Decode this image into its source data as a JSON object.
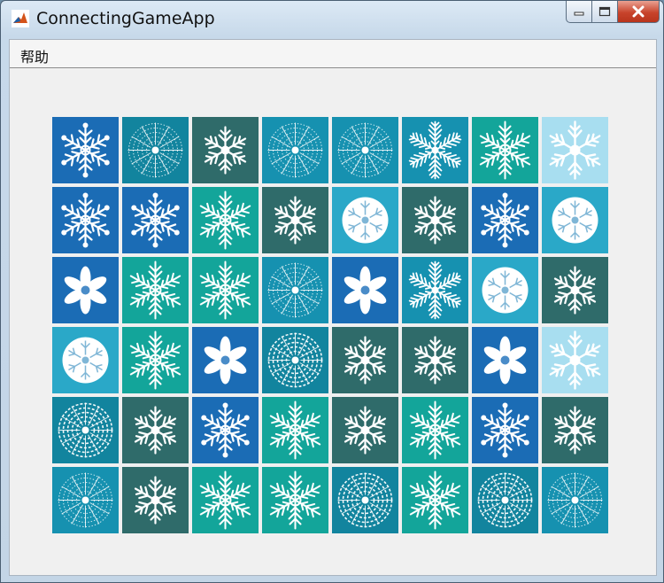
{
  "window": {
    "title": "ConnectingGameApp",
    "icon": "matlab-icon"
  },
  "menubar": {
    "items": [
      {
        "label": "帮助"
      }
    ]
  },
  "palette": {
    "A": "#1b6cb5",
    "B": "#1691b0",
    "C": "#2f6b6a",
    "D": "#13a59a",
    "E": "#2aa8c8",
    "F": "#a8def0",
    "G": "#12849e"
  },
  "board": {
    "rows": [
      [
        {
          "bg": "A",
          "icon": "snowflake-ornate-icon"
        },
        {
          "bg": "G",
          "icon": "mandala-snowflake-icon"
        },
        {
          "bg": "C",
          "icon": "snowflake-branch-icon"
        },
        {
          "bg": "B",
          "icon": "mandala-snowflake-icon"
        },
        {
          "bg": "B",
          "icon": "mandala-snowflake-icon"
        },
        {
          "bg": "B",
          "icon": "snowflake-fern-icon"
        },
        {
          "bg": "D",
          "icon": "snowflake-star-icon"
        },
        {
          "bg": "F",
          "icon": "snowflake-simple-icon"
        }
      ],
      [
        {
          "bg": "A",
          "icon": "snowflake-ornate-icon"
        },
        {
          "bg": "A",
          "icon": "snowflake-ornate-icon"
        },
        {
          "bg": "D",
          "icon": "snowflake-star-icon"
        },
        {
          "bg": "C",
          "icon": "snowflake-branch-icon"
        },
        {
          "bg": "E",
          "icon": "snowflake-round-icon"
        },
        {
          "bg": "C",
          "icon": "snowflake-branch-icon"
        },
        {
          "bg": "A",
          "icon": "snowflake-ornate-icon"
        },
        {
          "bg": "E",
          "icon": "snowflake-round-icon"
        }
      ],
      [
        {
          "bg": "A",
          "icon": "snowflake-puffy-icon"
        },
        {
          "bg": "D",
          "icon": "snowflake-star-icon"
        },
        {
          "bg": "D",
          "icon": "snowflake-star-icon"
        },
        {
          "bg": "B",
          "icon": "mandala-snowflake-icon"
        },
        {
          "bg": "A",
          "icon": "snowflake-puffy-icon"
        },
        {
          "bg": "B",
          "icon": "snowflake-fern-icon"
        },
        {
          "bg": "E",
          "icon": "snowflake-round-icon"
        },
        {
          "bg": "C",
          "icon": "snowflake-branch-icon"
        }
      ],
      [
        {
          "bg": "E",
          "icon": "snowflake-round-icon"
        },
        {
          "bg": "D",
          "icon": "snowflake-star-icon"
        },
        {
          "bg": "A",
          "icon": "snowflake-puffy-icon"
        },
        {
          "bg": "G",
          "icon": "mandala-lace-icon"
        },
        {
          "bg": "C",
          "icon": "snowflake-branch-icon"
        },
        {
          "bg": "C",
          "icon": "snowflake-branch-icon"
        },
        {
          "bg": "A",
          "icon": "snowflake-puffy-icon"
        },
        {
          "bg": "F",
          "icon": "snowflake-simple-icon"
        }
      ],
      [
        {
          "bg": "G",
          "icon": "mandala-lace-icon"
        },
        {
          "bg": "C",
          "icon": "snowflake-branch-icon"
        },
        {
          "bg": "A",
          "icon": "snowflake-ornate-icon"
        },
        {
          "bg": "D",
          "icon": "snowflake-star-icon"
        },
        {
          "bg": "C",
          "icon": "snowflake-branch-icon"
        },
        {
          "bg": "D",
          "icon": "snowflake-star-icon"
        },
        {
          "bg": "A",
          "icon": "snowflake-ornate-icon"
        },
        {
          "bg": "C",
          "icon": "snowflake-branch-icon"
        }
      ],
      [
        {
          "bg": "B",
          "icon": "mandala-snowflake-icon"
        },
        {
          "bg": "C",
          "icon": "snowflake-branch-icon"
        },
        {
          "bg": "D",
          "icon": "snowflake-star-icon"
        },
        {
          "bg": "D",
          "icon": "snowflake-star-icon"
        },
        {
          "bg": "G",
          "icon": "mandala-lace-icon"
        },
        {
          "bg": "D",
          "icon": "snowflake-star-icon"
        },
        {
          "bg": "G",
          "icon": "mandala-lace-icon"
        },
        {
          "bg": "B",
          "icon": "mandala-snowflake-icon"
        }
      ]
    ]
  }
}
